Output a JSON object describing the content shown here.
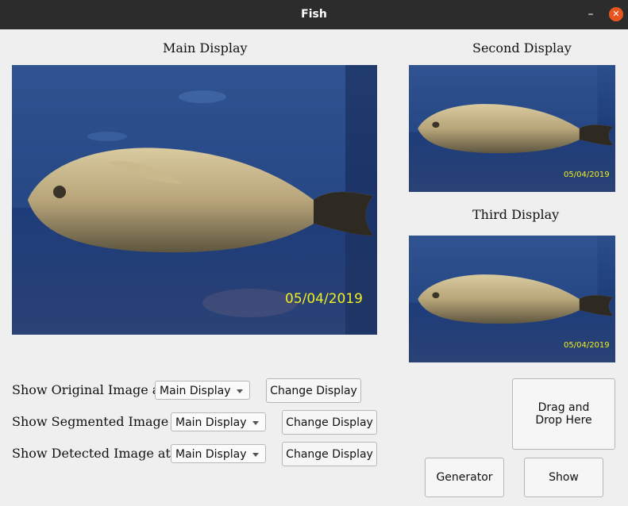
{
  "window": {
    "title": "Fish"
  },
  "displays": {
    "main": {
      "label": "Main Display",
      "date": "05/04/2019"
    },
    "second": {
      "label": "Second Display",
      "date": "05/04/2019"
    },
    "third": {
      "label": "Third Display",
      "date": "05/04/2019"
    }
  },
  "controls": {
    "original": {
      "label": "Show Original Image at :",
      "selected": "Main Display",
      "button": "Change Display"
    },
    "segmented": {
      "label": "Show Segmented Image at :",
      "selected": "Main Display",
      "button": "Change Display"
    },
    "detected": {
      "label": "Show Detected Image at :",
      "selected": "Main Display",
      "button": "Change Display"
    }
  },
  "actions": {
    "drop_zone": "Drag and Drop Here",
    "generator": "Generator",
    "show": "Show"
  },
  "colors": {
    "titlebar": "#2c2c2c",
    "close": "#e9541f",
    "date_text": "#f2ee1e",
    "background": "#efefef"
  }
}
